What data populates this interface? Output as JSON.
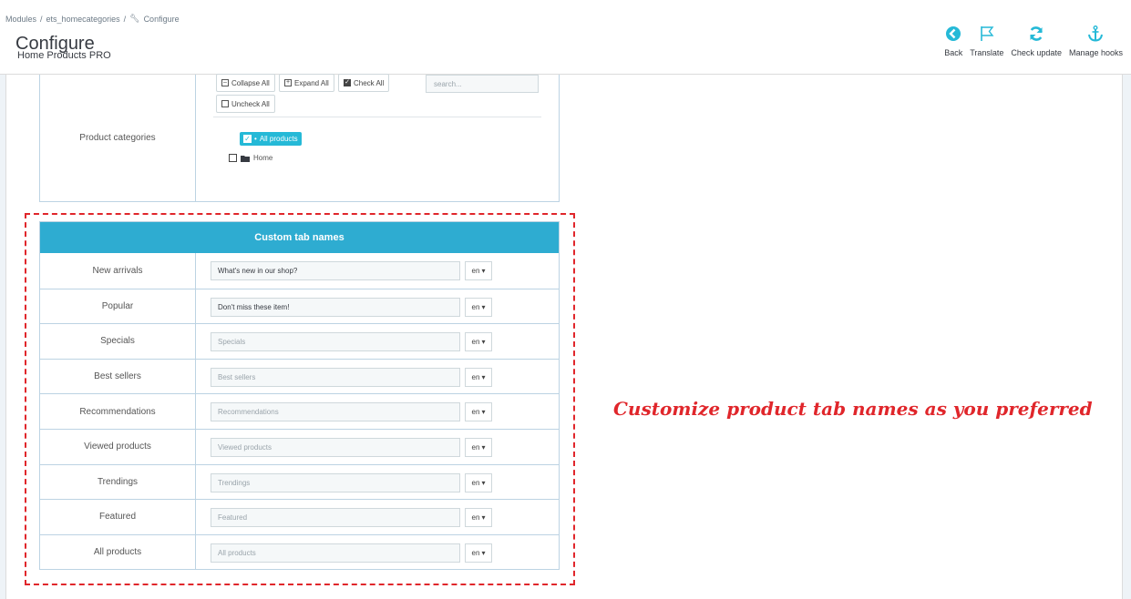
{
  "breadcrumb": [
    "Modules",
    "ets_homecategories",
    "Configure"
  ],
  "breadcrumb_sep": "/",
  "title": "Configure",
  "subtitle": "Home Products PRO",
  "toolbar": {
    "back": "Back",
    "translate": "Translate",
    "check_update": "Check update",
    "manage_hooks": "Manage hooks"
  },
  "categories": {
    "label": "Product categories",
    "collapse_all": "Collapse All",
    "expand_all": "Expand All",
    "check_all": "Check All",
    "uncheck_all": "Uncheck All",
    "search_placeholder": "search...",
    "tree_all_products": "All products",
    "tree_home": "Home"
  },
  "tab_names": {
    "header": "Custom tab names",
    "lang": "en",
    "rows": [
      {
        "label": "New arrivals",
        "value": "What's new in our shop?",
        "placeholder": ""
      },
      {
        "label": "Popular",
        "value": "Don't miss these item!",
        "placeholder": ""
      },
      {
        "label": "Specials",
        "value": "",
        "placeholder": "Specials"
      },
      {
        "label": "Best sellers",
        "value": "",
        "placeholder": "Best sellers"
      },
      {
        "label": "Recommendations",
        "value": "",
        "placeholder": "Recommendations"
      },
      {
        "label": "Viewed products",
        "value": "",
        "placeholder": "Viewed products"
      },
      {
        "label": "Trendings",
        "value": "",
        "placeholder": "Trendings"
      },
      {
        "label": "Featured",
        "value": "",
        "placeholder": "Featured"
      },
      {
        "label": "All products",
        "value": "",
        "placeholder": "All products"
      }
    ]
  },
  "callout": "Customize product tab names as you preferred",
  "colors": {
    "accent": "#25b9d7",
    "header_blue": "#2eacd1",
    "callout_red": "#e0262b"
  }
}
